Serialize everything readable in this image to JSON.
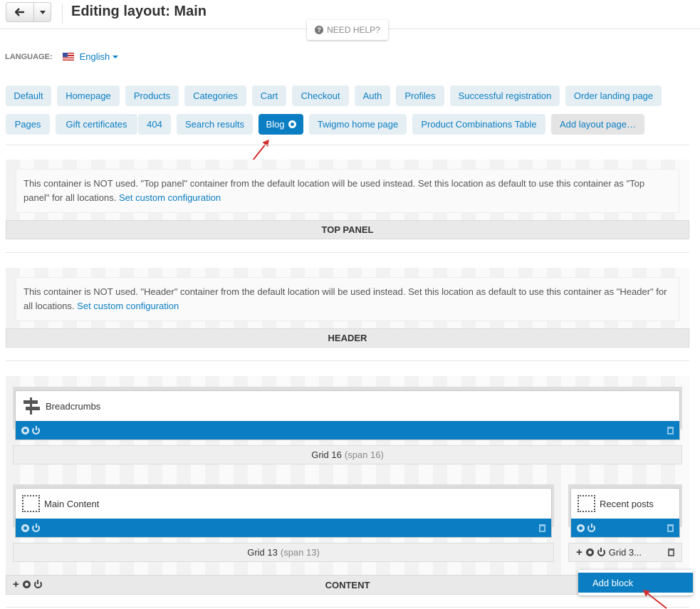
{
  "header": {
    "title": "Editing layout: Main",
    "help_label": "NEED HELP?"
  },
  "language": {
    "label": "LANGUAGE:",
    "value": "English"
  },
  "tabs": [
    {
      "label": "Default"
    },
    {
      "label": "Homepage"
    },
    {
      "label": "Products"
    },
    {
      "label": "Categories"
    },
    {
      "label": "Cart"
    },
    {
      "label": "Checkout"
    },
    {
      "label": "Auth"
    },
    {
      "label": "Profiles"
    },
    {
      "label": "Successful registration"
    },
    {
      "label": "Order landing page"
    },
    {
      "label": "Pages"
    },
    {
      "label": "Gift certificates"
    },
    {
      "label": "404"
    },
    {
      "label": "Search results"
    },
    {
      "label": "Blog",
      "active": true
    },
    {
      "label": "Twigmo home page"
    },
    {
      "label": "Product Combinations Table"
    },
    {
      "label": "Add layout page…"
    }
  ],
  "top_panel": {
    "notice": "This container is NOT used. \"Top panel\" container from the default location will be used instead. Set this location as default to use this container as \"Top panel\" for all locations.",
    "link": "Set custom configuration",
    "label": "TOP PANEL"
  },
  "header_container": {
    "notice": "This container is NOT used. \"Header\" container from the default location will be used instead. Set this location as default to use this container as \"Header\" for all locations.",
    "link": "Set custom configuration",
    "label": "HEADER"
  },
  "content": {
    "label": "CONTENT",
    "grid16": {
      "block": "Breadcrumbs",
      "name": "Grid 16",
      "span": "(span 16)"
    },
    "grid13": {
      "block": "Main Content",
      "name": "Grid 13",
      "span": "(span 13)"
    },
    "grid3": {
      "block": "Recent posts",
      "name": "Grid 3..."
    }
  },
  "add_block_menu": {
    "item": "Add block"
  },
  "colors": {
    "accent": "#0b7ec3",
    "annotation_arrow": "#d32f2f"
  }
}
